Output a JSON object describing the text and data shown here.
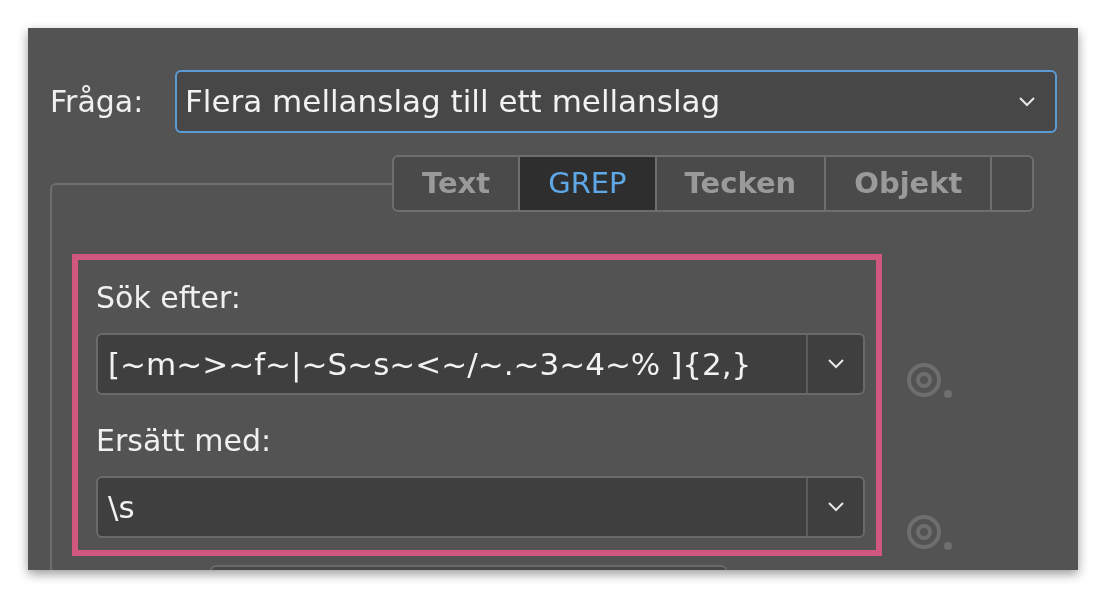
{
  "query": {
    "label": "Fråga:",
    "value": "Flera mellanslag till ett mellanslag"
  },
  "tabs": [
    {
      "label": "Text",
      "selected": false
    },
    {
      "label": "GREP",
      "selected": true
    },
    {
      "label": "Tecken",
      "selected": false
    },
    {
      "label": "Objekt",
      "selected": false
    }
  ],
  "find": {
    "label": "Sök efter:",
    "value": "[~m~>~f~|~S~s~<~/~.~3~4~% ]{2,}"
  },
  "change": {
    "label": "Ersätt med:",
    "value": "\\s"
  }
}
